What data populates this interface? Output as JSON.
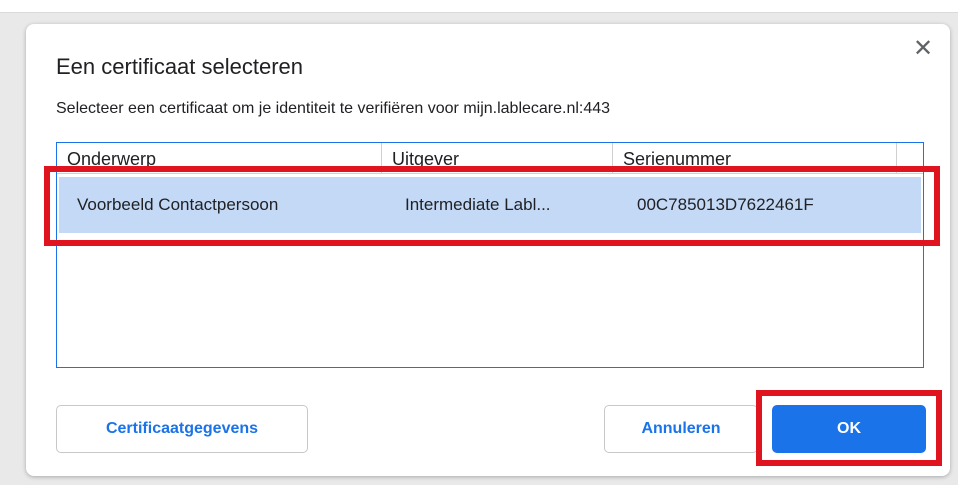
{
  "dialog": {
    "title": "Een certificaat selecteren",
    "description": "Selecteer een certificaat om je identiteit te verifiëren voor mijn.lablecare.nl:443",
    "close_glyph": "✕",
    "close_icon": "close-icon"
  },
  "table": {
    "columns": [
      "Onderwerp",
      "Uitgever",
      "Serienummer"
    ],
    "rows": [
      {
        "subject": "Voorbeeld Contactpersoon",
        "issuer": "Intermediate Labl...",
        "serial": "00C785013D7622461F",
        "selected": true
      }
    ]
  },
  "buttons": {
    "details": "Certificaatgegevens",
    "cancel": "Annuleren",
    "ok": "OK"
  },
  "colors": {
    "accent": "#1a73e8",
    "selection": "#c4d9f6",
    "highlight": "#e0141e"
  }
}
